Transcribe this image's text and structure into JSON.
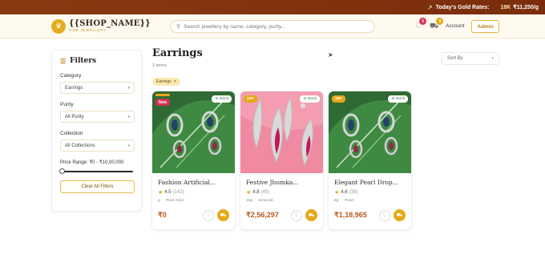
{
  "topbar": {
    "label": "Today's Gold Rates:",
    "rate_karat": "18K",
    "rate_value": "₹11,250/g",
    "icon": "trending-up-icon"
  },
  "header": {
    "brand_name": "{{SHOP_NAME}}",
    "brand_sub": "FINE JEWELLERY",
    "search_placeholder": "Search jewellery by name, category, purity...",
    "wishlist_count": "0",
    "cart_count": "0",
    "account_label": "Account",
    "admin_label": "Admin"
  },
  "filters": {
    "title": "Filters",
    "category_label": "Category",
    "category_value": "Earrings",
    "purity_label": "Purity",
    "purity_value": "All Purity",
    "collection_label": "Collection",
    "collection_value": "All Collections",
    "price_label": "Price Range: ₹0 - ₹10,00,000",
    "clear_label": "Clear All Filters"
  },
  "main": {
    "title": "Earrings",
    "count": "3 items",
    "active_chip": "Earrings",
    "sort_label": "Sort By"
  },
  "products": [
    {
      "purity": "",
      "stock": "In stock",
      "badge": "New",
      "name": "Fashion Artificial...",
      "rating": "4.5",
      "reviews": "(142)",
      "weight": "g",
      "material": "Pure Gold",
      "price": "₹0"
    },
    {
      "purity": "22K",
      "stock": "In stock",
      "badge": "",
      "name": "Festive Jhumka...",
      "rating": "4.8",
      "reviews": "(45)",
      "weight": "15g",
      "material": "Emerald",
      "price": "₹2,56,297"
    },
    {
      "purity": "18K",
      "stock": "In stock",
      "badge": "",
      "name": "Elegant Pearl Drop...",
      "rating": "4.6",
      "reviews": "(38)",
      "weight": "8g",
      "material": "Pearl",
      "price": "₹1,18,965"
    }
  ],
  "colors": {
    "accent": "#e5a817",
    "topbar": "#7a2d0c",
    "price": "#b55a1a",
    "stock": "#2d7a3e",
    "new": "#d62f55"
  }
}
